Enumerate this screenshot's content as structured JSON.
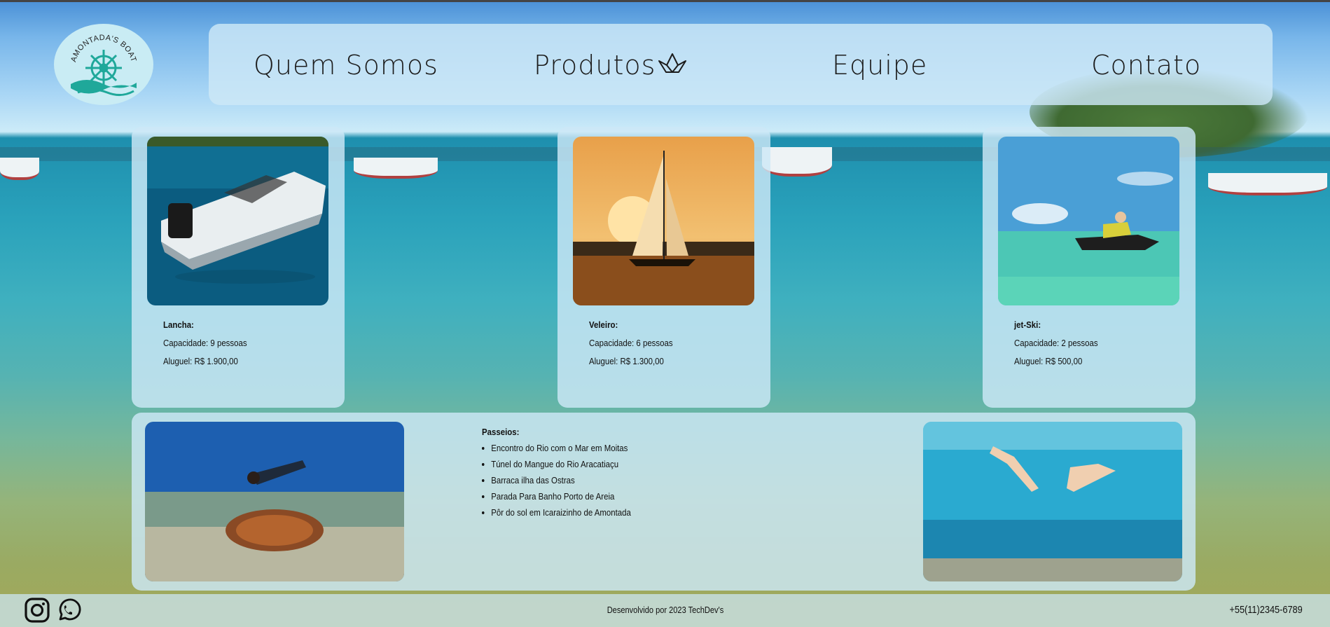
{
  "nav": {
    "logo_text": "AMONTADA'S BOAT",
    "items": [
      {
        "label": "Quem Somos"
      },
      {
        "label": "Produtos"
      },
      {
        "label": "Equipe"
      },
      {
        "label": "Contato"
      }
    ]
  },
  "products": [
    {
      "title": "Lancha:",
      "capacity": "Capacidade: 9 pessoas",
      "price": "Aluguel: R$ 1.900,00",
      "image": "speedboat"
    },
    {
      "title": "Veleiro:",
      "capacity": "Capacidade: 6 pessoas",
      "price": "Aluguel: R$ 1.300,00",
      "image": "sailboat-sunset"
    },
    {
      "title": "jet-Ski:",
      "capacity": "Capacidade: 2 pessoas",
      "price": "Aluguel: R$ 500,00",
      "image": "jet-ski"
    }
  ],
  "tours": {
    "title": "Passeios:",
    "items": [
      "Encontro do Rio com o Mar em Moitas",
      "Túnel do Mangue do Rio Aracatiaçu",
      "Barraca ilha das Ostras",
      "Parada Para Banho Porto de Areia",
      "Pôr do sol em Icaraizinho de Amontada"
    ]
  },
  "footer": {
    "credit": "Desenvolvido por 2023 TechDev's",
    "phone": "+55(11)2345-6789",
    "social": [
      "instagram-icon",
      "whatsapp-icon"
    ]
  },
  "colors": {
    "panel": "#cde8f6",
    "logo_teal": "#1fa89a",
    "text": "#111111"
  }
}
